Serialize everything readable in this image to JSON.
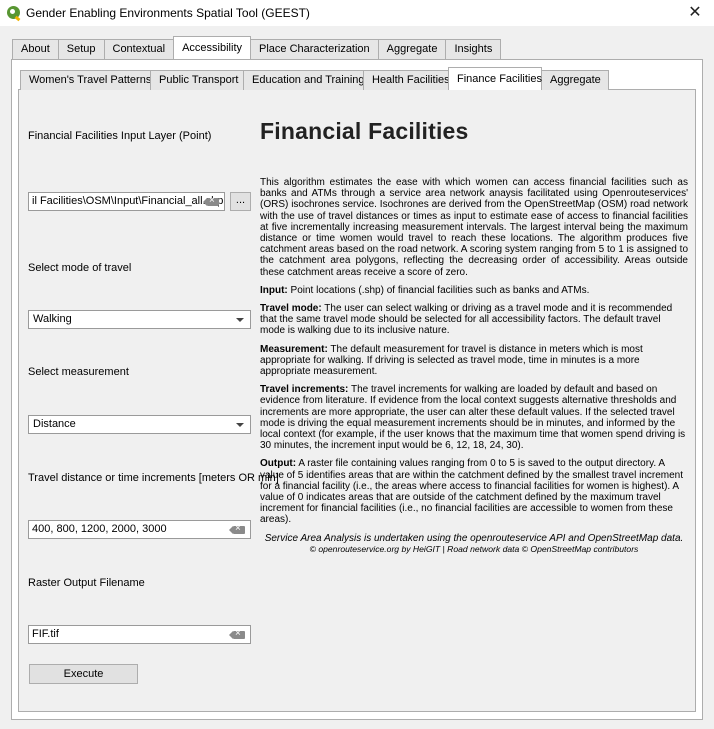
{
  "window": {
    "title": "Gender Enabling Environments Spatial Tool (GEEST)",
    "close_glyph": "✕"
  },
  "top_tabs": [
    {
      "label": "About"
    },
    {
      "label": "Setup"
    },
    {
      "label": "Contextual"
    },
    {
      "label": "Accessibility"
    },
    {
      "label": "Place Characterization"
    },
    {
      "label": "Aggregate"
    },
    {
      "label": "Insights"
    }
  ],
  "sub_tabs": [
    {
      "label": "Women's Travel Patterns"
    },
    {
      "label": "Public Transport"
    },
    {
      "label": "Education and Training"
    },
    {
      "label": "Health Facilities"
    },
    {
      "label": "Finance Facilities"
    },
    {
      "label": "Aggregate"
    }
  ],
  "form": {
    "input_layer_label": "Financial Facilities Input Layer (Point)",
    "input_layer_value": "il Facilities\\OSM\\Input\\Financial_all.shp",
    "browse_label": "...",
    "travel_mode_label": "Select mode of travel",
    "travel_mode_value": "Walking",
    "measurement_label": "Select measurement",
    "measurement_value": "Distance",
    "increments_label": "Travel distance or time increments [meters OR min]",
    "increments_value": "400, 800, 1200, 2000, 3000",
    "output_label": "Raster Output Filename",
    "output_value": "FIF.tif",
    "execute_label": "Execute"
  },
  "doc": {
    "title": "Financial Facilities",
    "intro": "This algorithm estimates the ease with which women can access financial facilities such as banks and ATMs through a service area network anaysis facilitated using Openrouteservices' (ORS) isochrones service. Isochrones are derived from the OpenStreetMap (OSM) road network with the use of travel distances or times as input to estimate ease of access to financial facilities at five incrementally increasing measurement intervals. The largest interval being the maximum distance or time women would travel to reach these locations. The algorithm produces five catchment areas based on the road network. A scoring system ranging from 5 to 1 is assigned to the catchment area polygons, reflecting the decreasing order of accessibility. Areas outside these catchment areas receive a score of zero.",
    "input_head": "Input:",
    "input_text": " Point locations (.shp) of financial facilities such as banks and ATMs.",
    "mode_head": "Travel mode:",
    "mode_text": " The user can select walking or driving as a travel mode and it is recommended that the same travel mode should be selected for all accessibility factors. The default travel mode is walking due to its inclusive nature.",
    "measure_head": "Measurement:",
    "measure_text": " The default measurement for travel is distance in meters which is most appropriate for walking. If driving is selected as travel mode, time in minutes is a more appropriate measurement.",
    "incr_head": "Travel increments:",
    "incr_text": " The travel increments for walking are loaded by default and based on evidence from literature. If evidence from the local context suggests alternative thresholds and increments are more appropriate, the user can alter these default values. If the selected travel mode is driving the equal measurement increments should be in minutes, and informed by the local context (for example, if the user knows that the maximum time that women spend driving is 30 minutes, the increment input would be 6, 12, 18, 24, 30).",
    "output_head": "Output:",
    "output_text": " A raster file containing values ranging from 0 to 5 is saved to the output directory. A value of 5 identifies areas that are within the catchment defined by the smallest travel increment for a financial facility (i.e., the areas where access to financial facilities for women is highest). A value of 0 indicates areas that are outside of the catchment defined by the maximum travel increment for financial facilities (i.e., no financial facilities are accessible to women from these areas).",
    "credit_line1": "Service Area Analysis is undertaken using the openrouteservice API and OpenStreetMap data.",
    "credit_line2": "© openrouteservice.org by HeiGIT | Road network data © OpenStreetMap contributors"
  }
}
